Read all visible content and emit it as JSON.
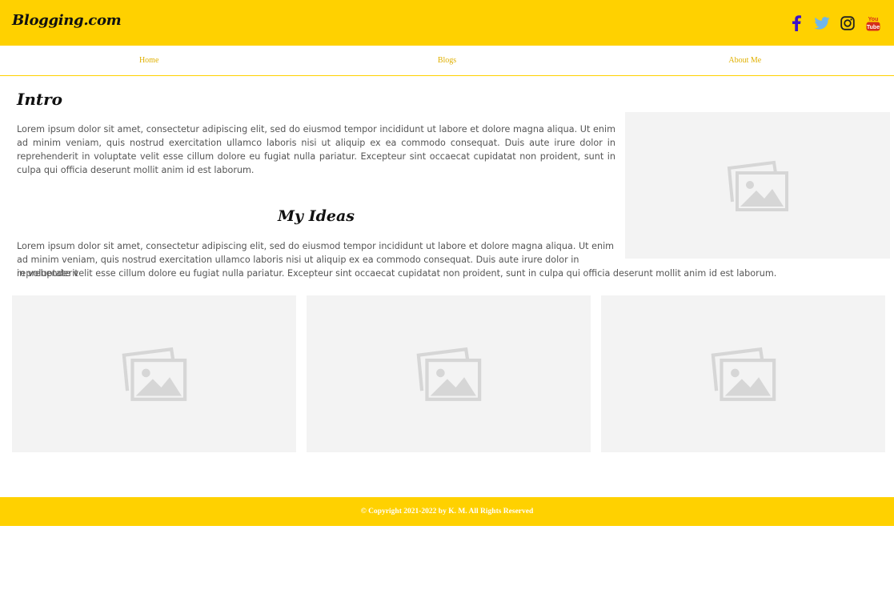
{
  "header": {
    "logo": "Blogging.com",
    "social": [
      {
        "icon": "facebook-icon",
        "color": "#3b12c9"
      },
      {
        "icon": "twitter-icon",
        "color": "#6fb6ea"
      },
      {
        "icon": "instagram-icon",
        "color": "#222222"
      },
      {
        "icon": "youtube-icon",
        "color": "#d62e1a"
      }
    ]
  },
  "nav": {
    "items": [
      {
        "label": "Home"
      },
      {
        "label": "Blogs"
      },
      {
        "label": "About Me"
      }
    ]
  },
  "intro": {
    "title": "Intro",
    "text": "Lorem ipsum dolor sit amet, consectetur adipiscing elit, sed do eiusmod tempor incididunt ut labore et dolore magna aliqua. Ut enim ad minim veniam, quis nostrud exercitation ullamco laboris nisi ut aliquip ex ea commodo consequat. Duis aute irure dolor in reprehenderit in voluptate velit esse cillum dolore eu fugiat nulla pariatur. Excepteur sint occaecat cupidatat non proident, sunt in culpa qui officia deserunt mollit anim id est laborum."
  },
  "ideas": {
    "title": "My Ideas",
    "text_part1": "Lorem ipsum dolor sit amet, consectetur adipiscing elit, sed do eiusmod tempor incididunt ut labore et dolore magna aliqua. Ut enim ad minim veniam, quis nostrud exercitation ullamco laboris nisi ut aliquip ex ea commodo consequat. Duis aute irure dolor in reprehenderit",
    "text_part2": "in voluptate velit esse cillum dolore eu fugiat nulla pariatur. Excepteur sint occaecat cupidatat non proident, sunt in culpa qui officia deserunt mollit anim id est laborum."
  },
  "images": {
    "placeholder_icon": "image-placeholder-icon"
  },
  "footer": {
    "text": "© Copyright 2021-2022 by K. M. All Rights Reserved"
  },
  "colors": {
    "accent": "#ffd100",
    "nav_link": "#e0b000",
    "placeholder_bg": "#f3f3f3"
  }
}
